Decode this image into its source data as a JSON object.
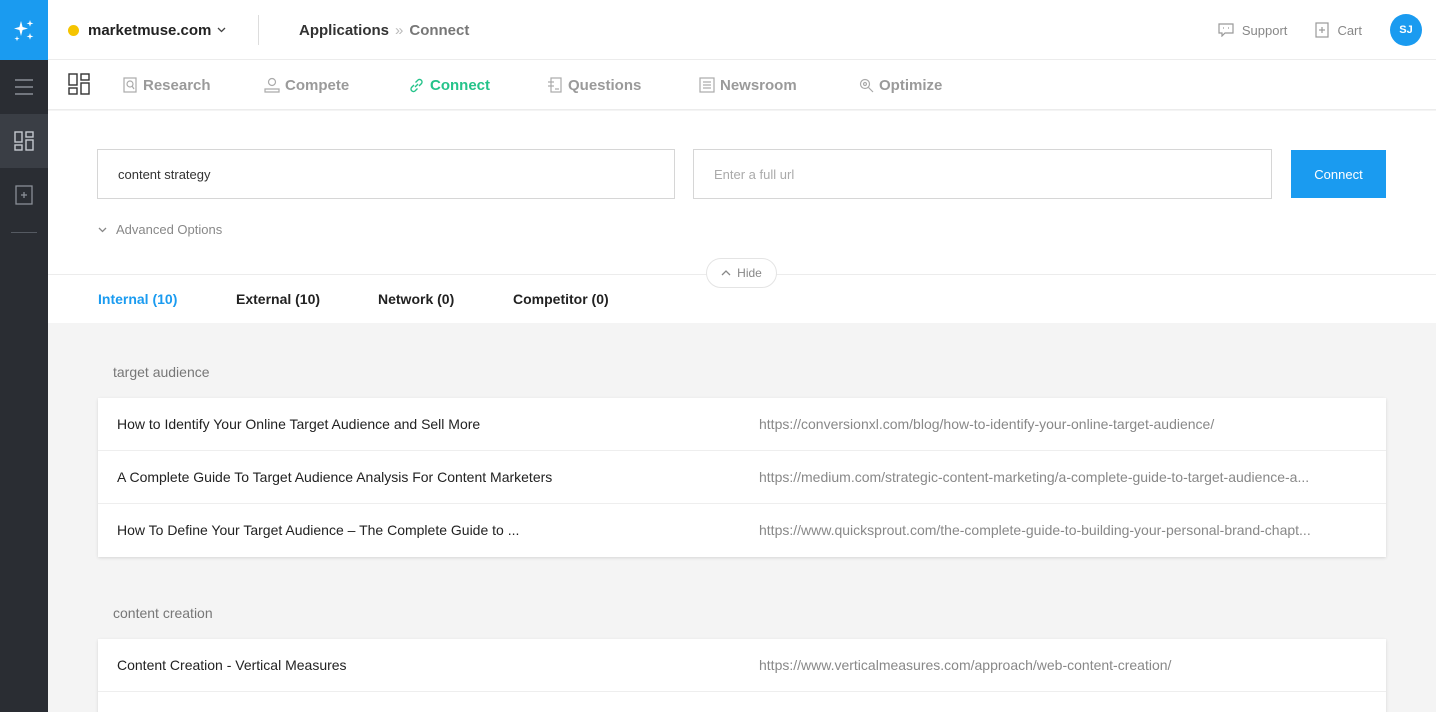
{
  "topbar": {
    "site_name": "marketmuse.com",
    "breadcrumb_app": "Applications",
    "breadcrumb_sep": "»",
    "breadcrumb_current": "Connect",
    "support_label": "Support",
    "cart_label": "Cart",
    "avatar_initials": "SJ"
  },
  "appnav": {
    "items": [
      {
        "label": "Research",
        "icon": "research-icon"
      },
      {
        "label": "Compete",
        "icon": "compete-icon"
      },
      {
        "label": "Connect",
        "icon": "link-icon",
        "active": true
      },
      {
        "label": "Questions",
        "icon": "questions-icon"
      },
      {
        "label": "Newsroom",
        "icon": "newsroom-icon"
      },
      {
        "label": "Optimize",
        "icon": "optimize-icon"
      }
    ]
  },
  "form": {
    "topic_value": "content strategy",
    "url_placeholder": "Enter a full url",
    "connect_label": "Connect",
    "advanced_label": "Advanced Options",
    "hide_label": "Hide"
  },
  "tabs": [
    {
      "label": "Internal (10)",
      "active": true
    },
    {
      "label": "External (10)"
    },
    {
      "label": "Network (0)"
    },
    {
      "label": "Competitor (0)"
    }
  ],
  "groups": [
    {
      "title": "target audience",
      "rows": [
        {
          "title": "How to Identify Your Online Target Audience and Sell More",
          "url": "https://conversionxl.com/blog/how-to-identify-your-online-target-audience/"
        },
        {
          "title": "A Complete Guide To Target Audience Analysis For Content Marketers",
          "url": "https://medium.com/strategic-content-marketing/a-complete-guide-to-target-audience-a..."
        },
        {
          "title": "How To Define Your Target Audience – The Complete Guide to ...",
          "url": "https://www.quicksprout.com/the-complete-guide-to-building-your-personal-brand-chapt..."
        }
      ]
    },
    {
      "title": "content creation",
      "rows": [
        {
          "title": "Content Creation - Vertical Measures",
          "url": "https://www.verticalmeasures.com/approach/web-content-creation/"
        },
        {
          "title": "",
          "url": ""
        }
      ]
    }
  ],
  "colors": {
    "accent": "#1a9bf0",
    "connect_green": "#25c38a",
    "rail": "#2a2d33",
    "site_dot": "#f5c400"
  }
}
